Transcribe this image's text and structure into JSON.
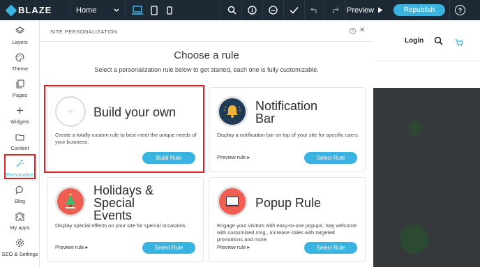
{
  "topbar": {
    "logo": "BLAZE",
    "page_select": "Home",
    "preview": "Preview",
    "republish": "Republish",
    "help": "?"
  },
  "sidebar": {
    "items": [
      {
        "label": "Layers",
        "icon": "layers-icon"
      },
      {
        "label": "Theme",
        "icon": "palette-icon"
      },
      {
        "label": "Pages",
        "icon": "pages-icon"
      },
      {
        "label": "Widgets",
        "icon": "plus-icon"
      },
      {
        "label": "Content",
        "icon": "folder-icon"
      },
      {
        "label": "Personalize",
        "icon": "personalize-icon"
      },
      {
        "label": "Blog",
        "icon": "chat-icon"
      },
      {
        "label": "My apps",
        "icon": "apps-icon"
      },
      {
        "label": "SEO & Settings",
        "icon": "gear-icon"
      }
    ],
    "active": "Personalize"
  },
  "panel": {
    "title": "SITE PERSONALIZATION",
    "heading": "Choose a rule",
    "subheading": "Select a personalization rule below to get started, each one is fully customizable.",
    "cards": [
      {
        "title": "Build your own",
        "desc": "Create a totally custom rule to best meet the unique needs of your business.",
        "button": "Build Rule",
        "preview": ""
      },
      {
        "title_1": "Notification",
        "title_2": "Bar",
        "desc": "Display a notification bar on top of your site for specific users.",
        "button": "Select Rule",
        "preview": "Preview rule"
      },
      {
        "title_1": "Holidays &",
        "title_2": "Special",
        "title_3": "Events",
        "desc": "Display special effects on your site for special occasions.",
        "button": "Select Rule",
        "preview": "Preview rule"
      },
      {
        "title": "Popup Rule",
        "desc": "Engage your visitors with easy-to-use popups. Say welcome with customized msg., increase sales with targeted promotions and more.",
        "button": "Select Rule",
        "preview": "Preview rule"
      }
    ]
  },
  "site": {
    "login": "Login"
  },
  "colors": {
    "accent": "#3ab3e0",
    "highlight": "#e02020",
    "topbar": "#1d2a36"
  }
}
